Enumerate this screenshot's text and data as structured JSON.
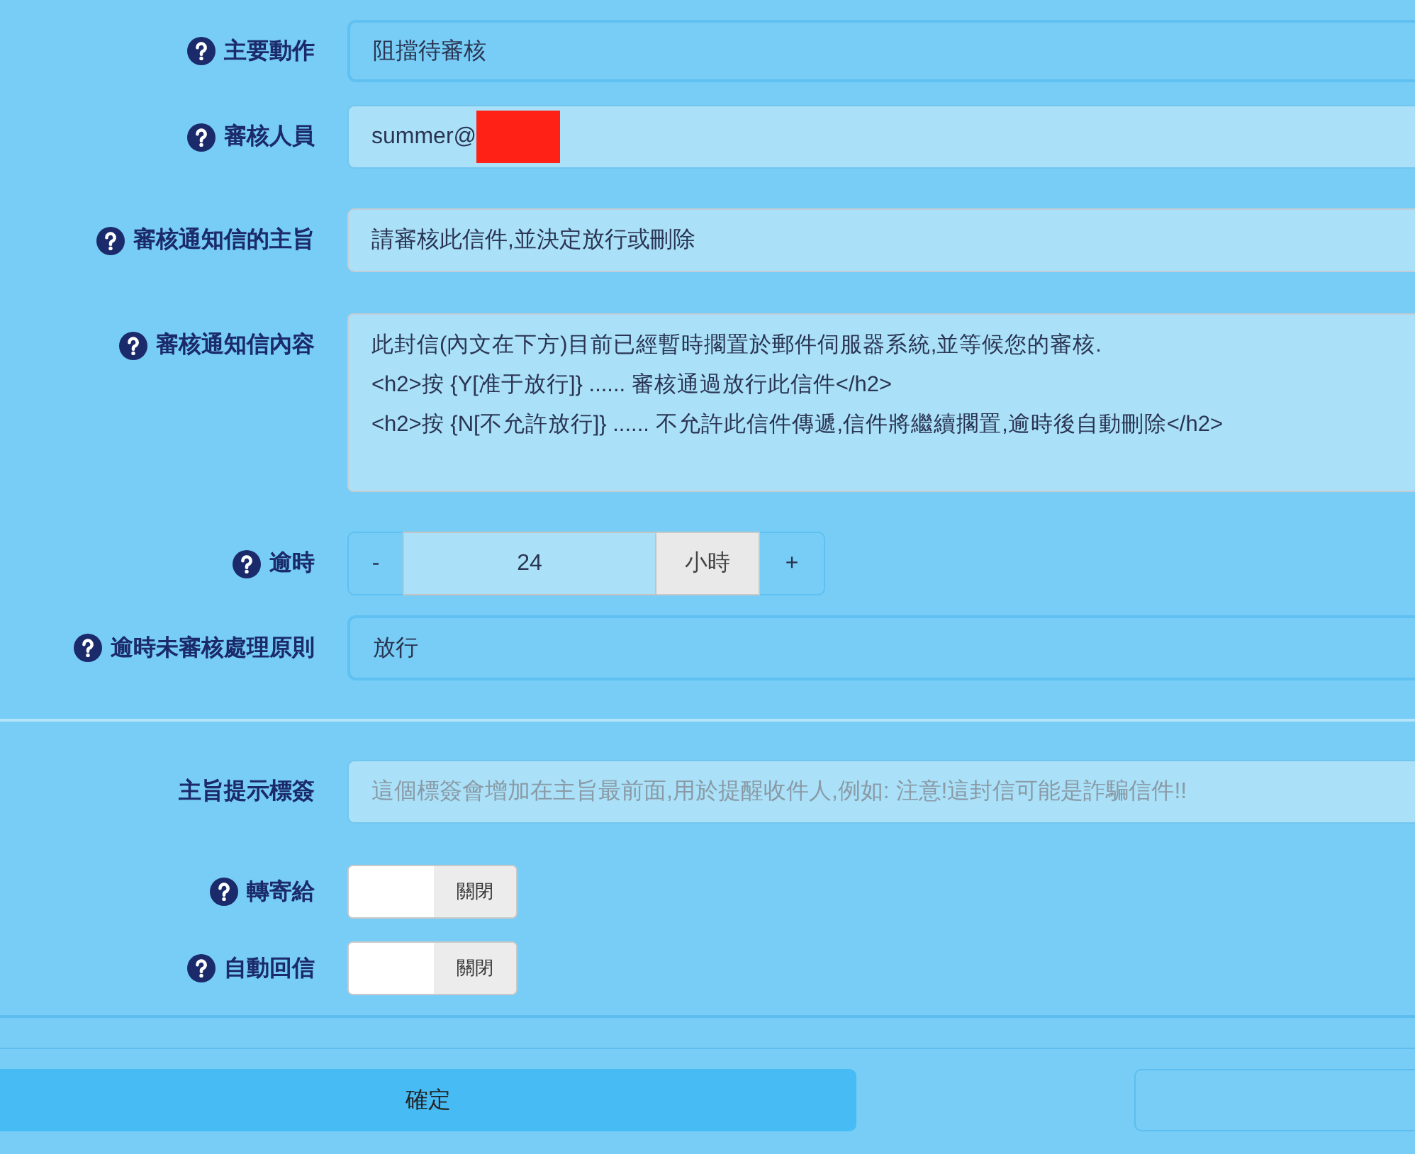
{
  "form": {
    "fields": [
      {
        "kind": "select",
        "label": "主要動作",
        "help": true,
        "value": "阻擋待審核"
      },
      {
        "kind": "input",
        "label": "審核人員",
        "help": true,
        "value": "summer@",
        "redacted": true
      },
      {
        "kind": "input",
        "label": "審核通知信的主旨",
        "help": true,
        "value": "請審核此信件,並決定放行或刪除"
      },
      {
        "kind": "textarea",
        "label": "審核通知信內容",
        "help": true,
        "value": "此封信(內文在下方)目前已經暫時擱置於郵件伺服器系統,並等候您的審核.\n<h2>按 {Y[准于放行]} ...... 審核通過放行此信件</h2>\n<h2>按 {N[不允許放行]} ...... 不允許此信件傳遞,信件將繼續擱置,逾時後自動刪除</h2>"
      },
      {
        "kind": "stepper",
        "label": "逾時",
        "help": true,
        "minus": "-",
        "value": "24",
        "unit": "小時",
        "plus": "+"
      },
      {
        "kind": "select",
        "label": "逾時未審核處理原則",
        "help": true,
        "value": "放行"
      }
    ]
  },
  "options": {
    "fields": [
      {
        "kind": "input",
        "label": "主旨提示標簽",
        "help": false,
        "placeholder": "這個標簽會增加在主旨最前面,用於提醒收件人,例如: 注意!這封信可能是詐騙信件!!"
      },
      {
        "kind": "toggle",
        "label": "轉寄給",
        "help": true,
        "on": false,
        "state_label": "關閉"
      },
      {
        "kind": "toggle",
        "label": "自動回信",
        "help": true,
        "on": false,
        "state_label": "關閉"
      }
    ]
  },
  "buttons": [
    {
      "kind": "primary",
      "label": "確定"
    },
    {
      "kind": "secondary"
    }
  ]
}
